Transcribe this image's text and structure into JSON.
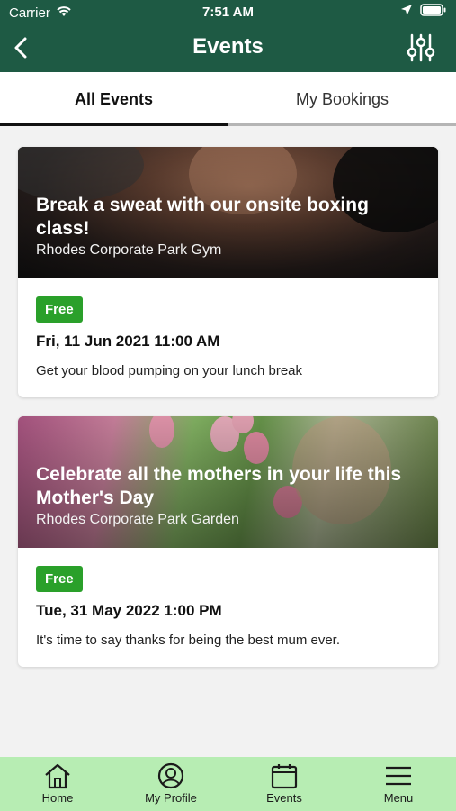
{
  "status_bar": {
    "carrier": "Carrier",
    "time": "7:51 AM"
  },
  "header": {
    "title": "Events"
  },
  "tabs": [
    {
      "label": "All Events",
      "active": true
    },
    {
      "label": "My Bookings",
      "active": false
    }
  ],
  "events": [
    {
      "title": "Break a sweat with our onsite boxing class!",
      "location": "Rhodes Corporate Park Gym",
      "price_badge": "Free",
      "datetime": "Fri, 11 Jun 2021 11:00 AM",
      "description": "Get your blood pumping on your lunch break"
    },
    {
      "title": "Celebrate all the mothers in your life this Mother's Day",
      "location": "Rhodes Corporate Park Garden",
      "price_badge": "Free",
      "datetime": "Tue, 31 May 2022 1:00 PM",
      "description": "It's time to say thanks for being the best mum ever."
    }
  ],
  "bottom_nav": [
    {
      "label": "Home",
      "icon": "home-icon"
    },
    {
      "label": "My Profile",
      "icon": "profile-icon"
    },
    {
      "label": "Events",
      "icon": "calendar-icon"
    },
    {
      "label": "Menu",
      "icon": "menu-icon"
    }
  ],
  "colors": {
    "header_bg": "#1e5a44",
    "badge_bg": "#2aa02a",
    "bottom_nav_bg": "#b7edb3",
    "page_bg": "#f2f2f2"
  }
}
